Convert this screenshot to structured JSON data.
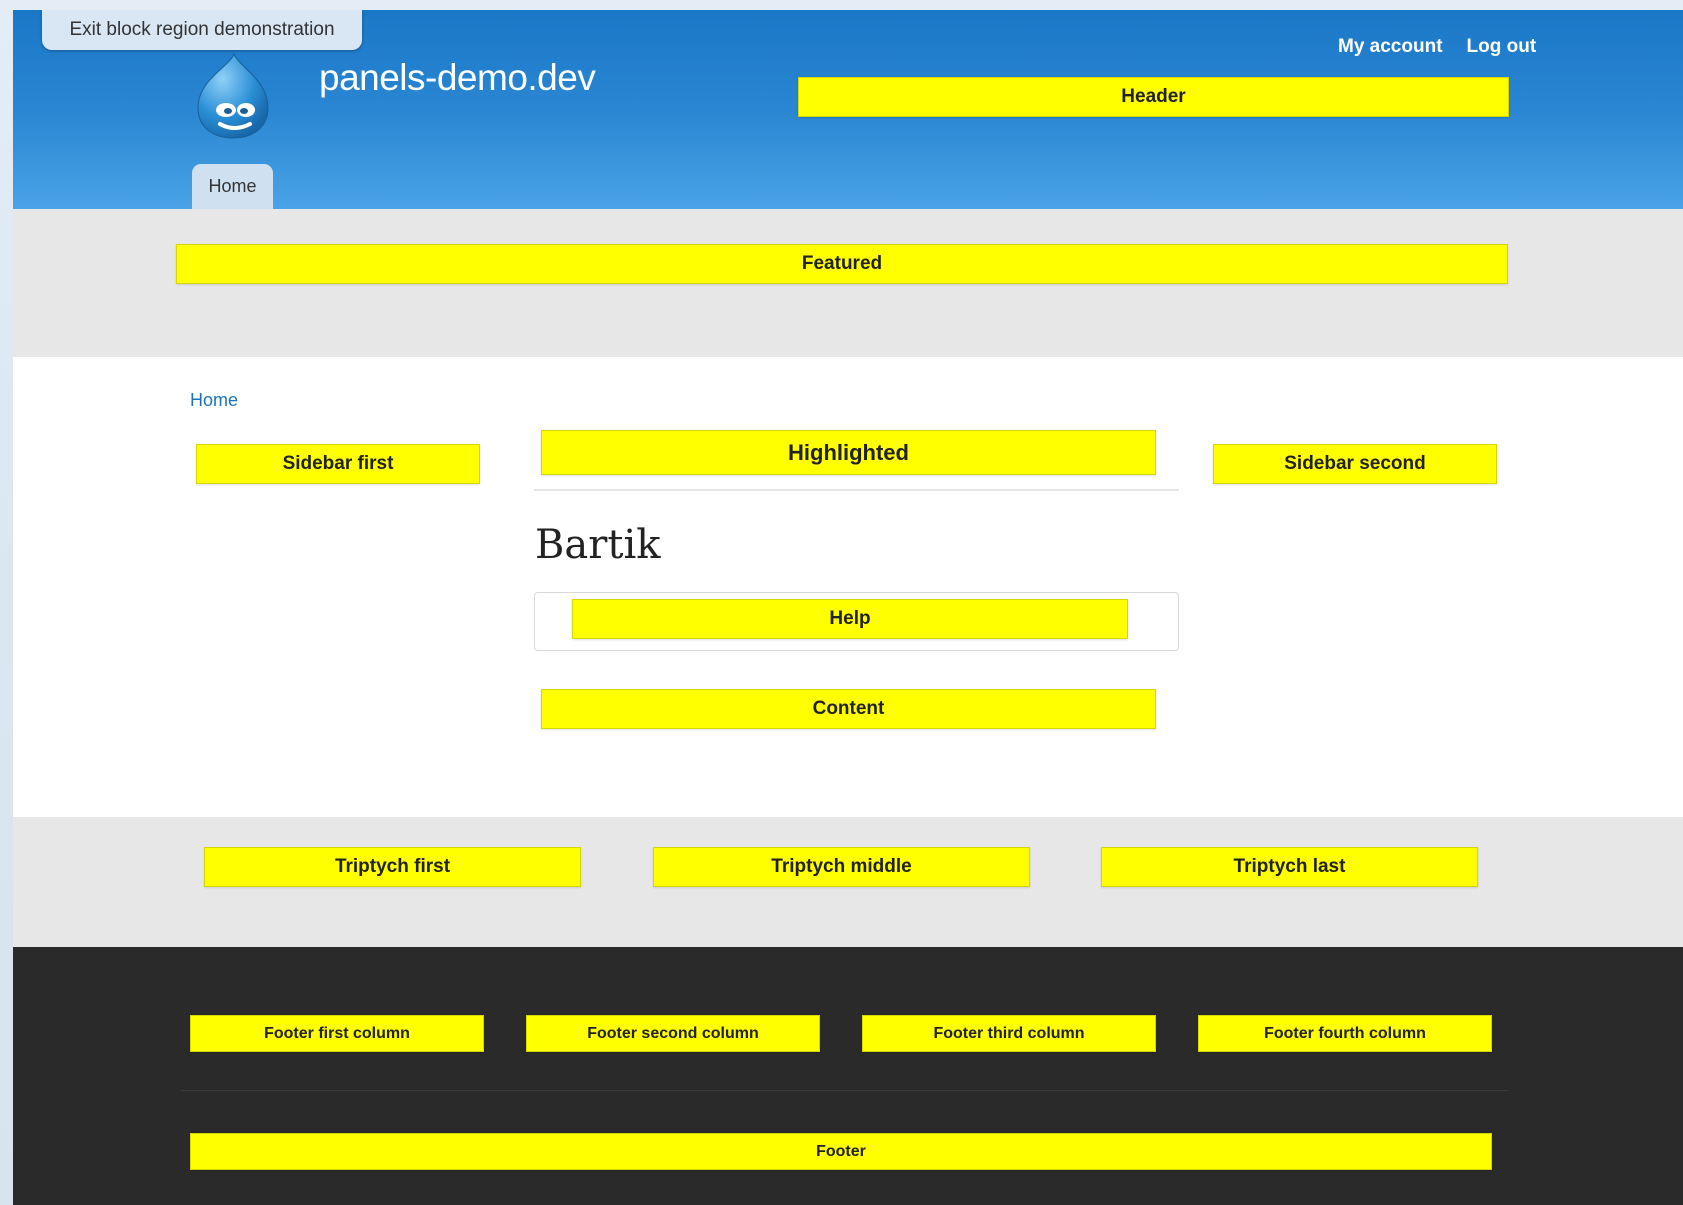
{
  "toolbar": {
    "exit_label": "Exit block region demonstration"
  },
  "header": {
    "site_name": "panels-demo.dev",
    "secondary_menu": [
      "My account",
      "Log out"
    ],
    "main_menu": [
      "Home"
    ],
    "region_label": "Header"
  },
  "featured": {
    "region_label": "Featured"
  },
  "main": {
    "breadcrumb": "Home",
    "page_title": "Bartik",
    "regions": {
      "sidebar_first": "Sidebar first",
      "highlighted": "Highlighted",
      "sidebar_second": "Sidebar second",
      "help": "Help",
      "content": "Content"
    }
  },
  "triptych": {
    "regions": [
      "Triptych first",
      "Triptych middle",
      "Triptych last"
    ]
  },
  "footer": {
    "columns": [
      "Footer first column",
      "Footer second column",
      "Footer third column",
      "Footer fourth column"
    ],
    "region_label": "Footer"
  },
  "colors": {
    "region_highlight": "#ffff00",
    "header_blue": "#1a78c8",
    "band_gray": "#e7e7e7",
    "footer_dark": "#2a2a2a",
    "link_blue": "#1b74b8"
  }
}
